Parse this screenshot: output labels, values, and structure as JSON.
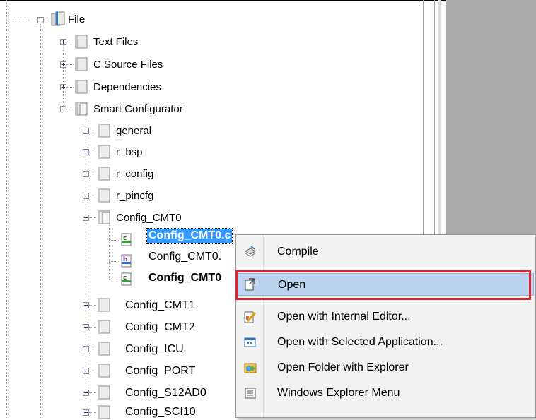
{
  "tree": {
    "root": {
      "label": "File"
    },
    "folders": [
      {
        "label": "Text Files"
      },
      {
        "label": "C Source Files"
      },
      {
        "label": "Dependencies"
      },
      {
        "label": "Smart Configurator"
      }
    ],
    "sc_children": [
      {
        "label": "general"
      },
      {
        "label": "r_bsp"
      },
      {
        "label": "r_config"
      },
      {
        "label": "r_pincfg"
      },
      {
        "label": "Config_CMT0"
      }
    ],
    "cmt0_files": [
      {
        "label": "Config_CMT0.c",
        "icon": "c-source-file-icon"
      },
      {
        "label": "Config_CMT0.",
        "icon": "header-file-icon"
      },
      {
        "label": "Config_CMT0",
        "icon": "c-source-file-icon"
      }
    ],
    "more_folders": [
      {
        "label": "Config_CMT1"
      },
      {
        "label": "Config_CMT2"
      },
      {
        "label": "Config_ICU"
      },
      {
        "label": "Config_PORT"
      },
      {
        "label": "Config_S12AD0"
      },
      {
        "label": "Config_SCI10"
      }
    ]
  },
  "context_menu": {
    "items": [
      {
        "label": "Compile",
        "icon": "compile-icon"
      },
      {
        "label": "Open",
        "icon": "open-file-icon",
        "highlighted": true
      },
      {
        "label": "Open with Internal Editor...",
        "icon": "internal-editor-icon"
      },
      {
        "label": "Open with Selected Application...",
        "icon": "selected-application-icon"
      },
      {
        "label": "Open Folder with Explorer",
        "icon": "explorer-folder-icon"
      },
      {
        "label": "Windows Explorer Menu",
        "icon": "explorer-menu-icon"
      }
    ]
  },
  "colors": {
    "selection": "#3399ff",
    "menu_highlight": "#bcd3ef",
    "annotation_frame": "#e3232f",
    "right_pane": "#ababab"
  }
}
